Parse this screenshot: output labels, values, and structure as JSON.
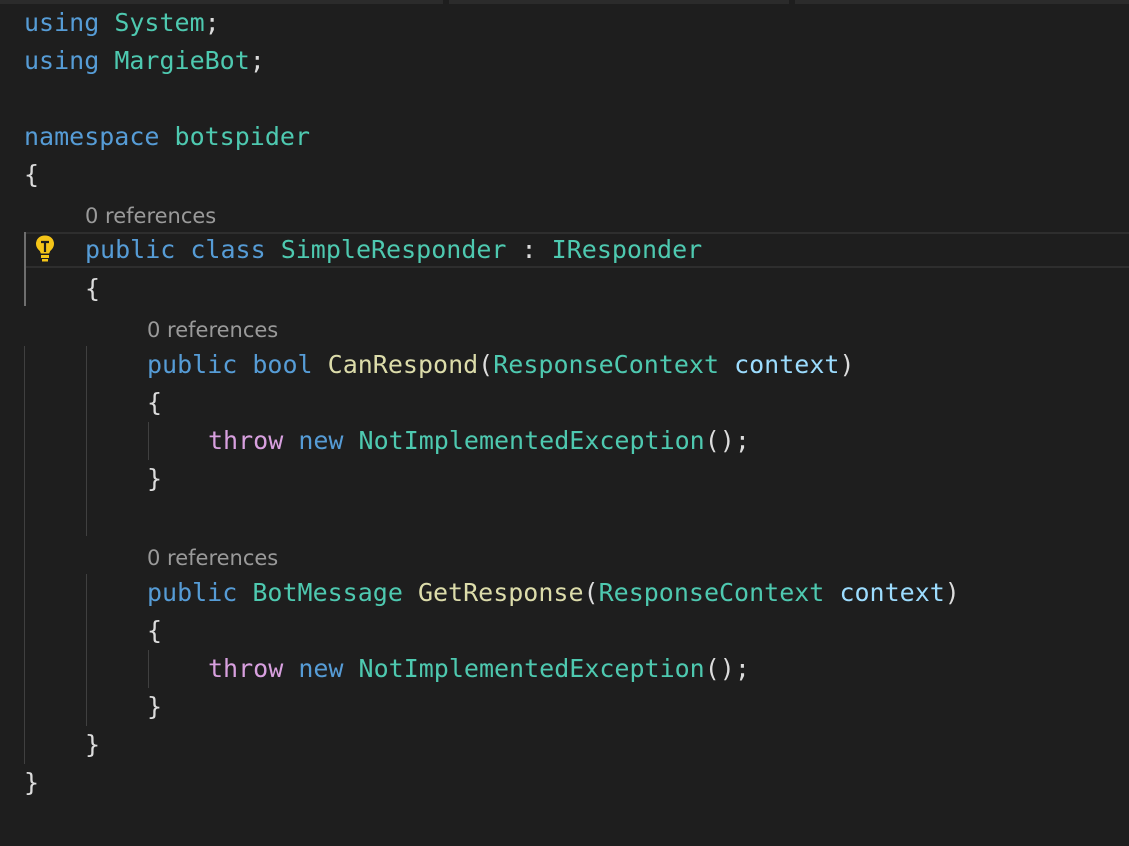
{
  "code": {
    "line1": {
      "kw": "using",
      "ns": "System",
      "semi": ";"
    },
    "line2": {
      "kw": "using",
      "ns": "MargieBot",
      "semi": ";"
    },
    "line4": {
      "kw": "namespace",
      "name": "botspider"
    },
    "line5": {
      "brace": "{"
    },
    "lens_class": "0 references",
    "line6": {
      "kw1": "public",
      "kw2": "class",
      "name": "SimpleResponder",
      "colon": ":",
      "base": "IResponder"
    },
    "line7": {
      "brace": "{"
    },
    "lens_m1": "0 references",
    "line9": {
      "kw1": "public",
      "kw2": "bool",
      "fn": "CanRespond",
      "open": "(",
      "ptype": "ResponseContext",
      "pname": "context",
      "close": ")"
    },
    "line10": {
      "brace": "{"
    },
    "line11": {
      "ctl": "throw",
      "kw": "new",
      "type": "NotImplementedException",
      "tail": "();"
    },
    "line12": {
      "brace": "}"
    },
    "lens_m2": "0 references",
    "line14": {
      "kw1": "public",
      "rtype": "BotMessage",
      "fn": "GetResponse",
      "open": "(",
      "ptype": "ResponseContext",
      "pname": "context",
      "close": ")"
    },
    "line15": {
      "brace": "{"
    },
    "line16": {
      "ctl": "throw",
      "kw": "new",
      "type": "NotImplementedException",
      "tail": "();"
    },
    "line17": {
      "brace": "}"
    },
    "line18": {
      "brace": "}"
    },
    "line19": {
      "brace": "}"
    }
  },
  "icons": {
    "lightbulb": "lightbulb-icon"
  },
  "theme": {
    "background": "#1e1e1e",
    "keyword": "#569cd6",
    "type": "#4ec9b0",
    "function": "#dcdcaa",
    "control": "#d8a0df",
    "parameter": "#9cdcfe",
    "text": "#dcdcdc",
    "codelens": "#9a9a9a"
  }
}
